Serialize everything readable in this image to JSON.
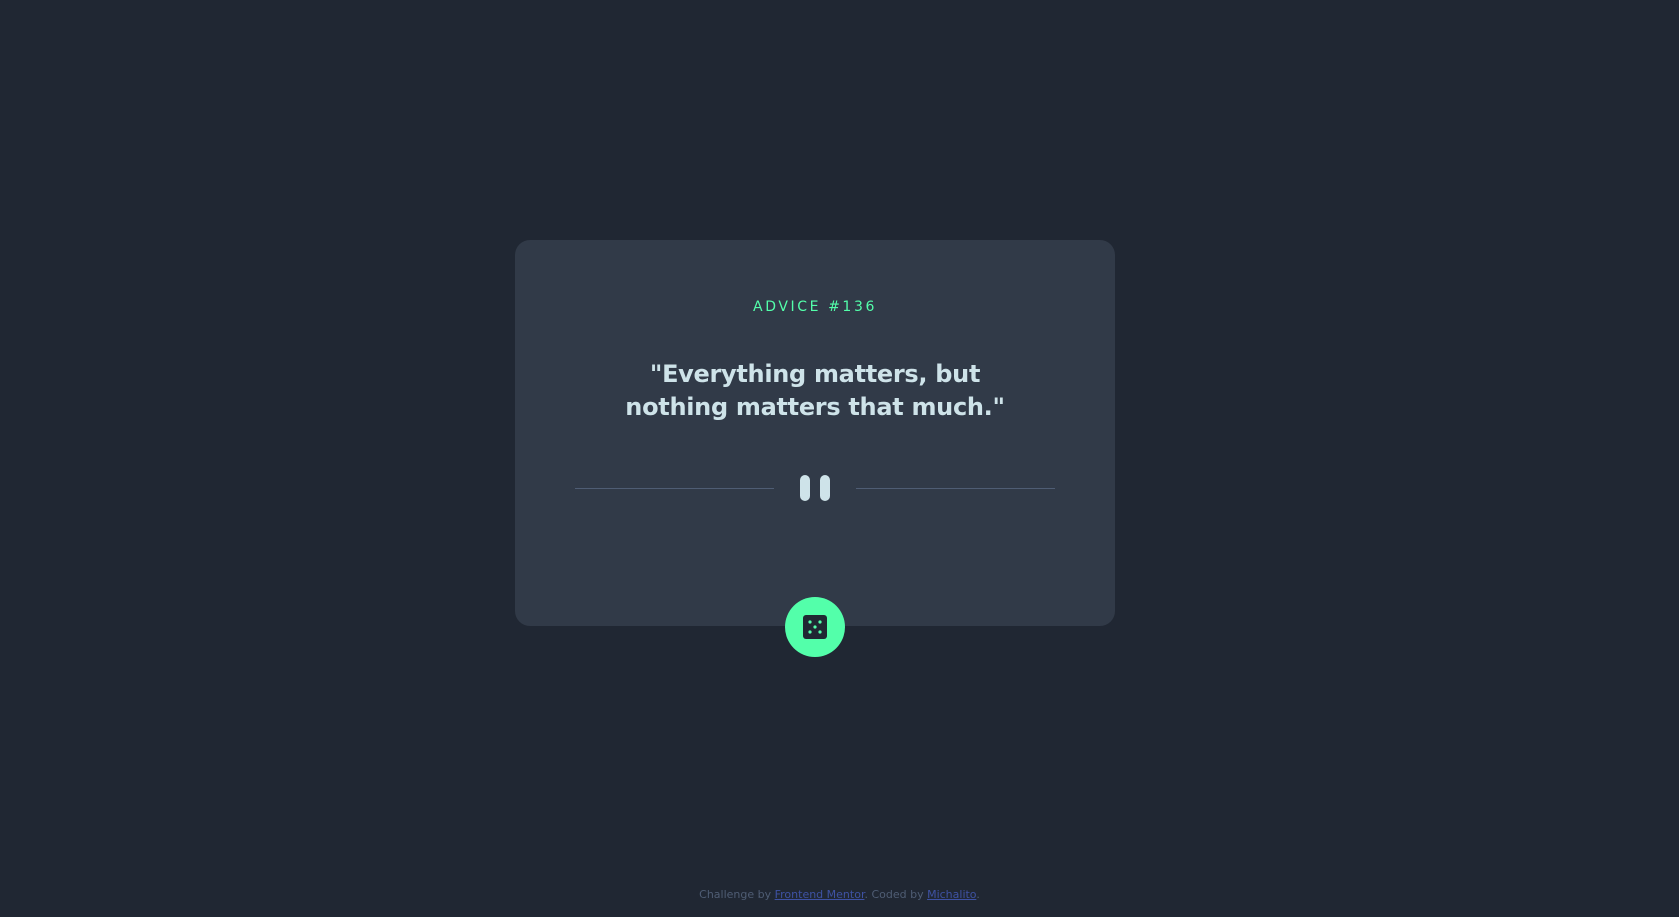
{
  "card": {
    "advice_label": "ADVICE #136",
    "quote": "\"Everything matters, but nothing matters that much.\"",
    "divider_icon": "pause-icon",
    "dice_icon": "dice-icon"
  },
  "footer": {
    "prefix": "Challenge by ",
    "challenge_link": "Frontend Mentor",
    "middle": ". Coded by ",
    "author_link": "Michalito",
    "suffix": "."
  },
  "colors": {
    "background": "#202733",
    "card": "#313a48",
    "accent": "#53ffaa",
    "text": "#cee3e9",
    "divider": "#4f5d74",
    "link": "#3e52a3"
  }
}
